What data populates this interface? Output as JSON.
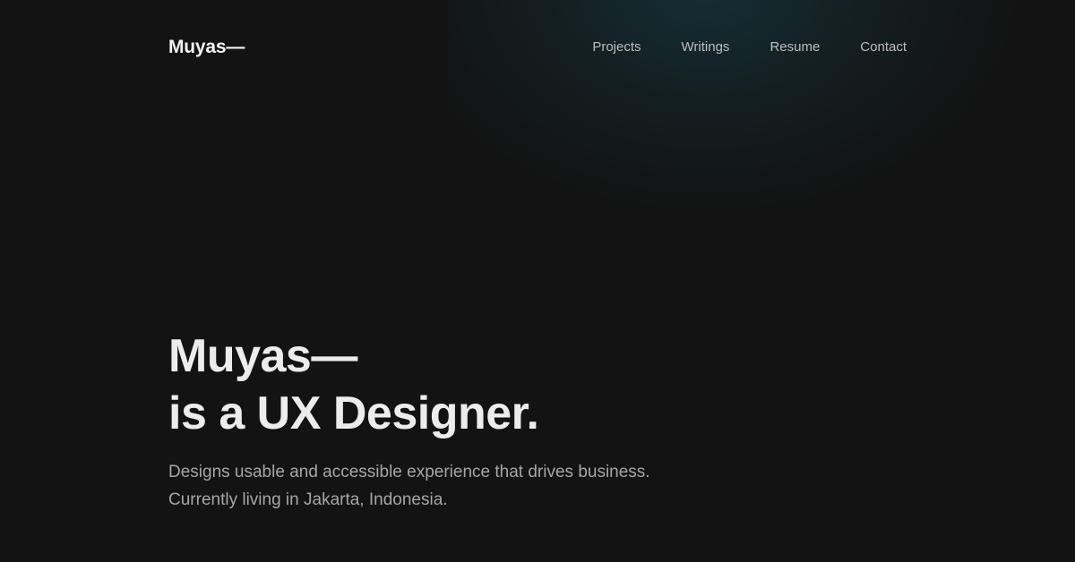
{
  "header": {
    "logo": "Muyas—",
    "nav": [
      {
        "label": "Projects"
      },
      {
        "label": "Writings"
      },
      {
        "label": "Resume"
      },
      {
        "label": "Contact"
      }
    ]
  },
  "hero": {
    "title_line1": "Muyas—",
    "title_line2": "is a UX Designer.",
    "desc_line1": "Designs usable and accessible experience that drives business.",
    "desc_line2": "Currently living in Jakarta, Indonesia."
  },
  "colors": {
    "background": "#131313",
    "glow": "#14343a",
    "heading": "#ececec",
    "nav_text": "#bdbdbd",
    "body_text": "#a6a6a6"
  }
}
